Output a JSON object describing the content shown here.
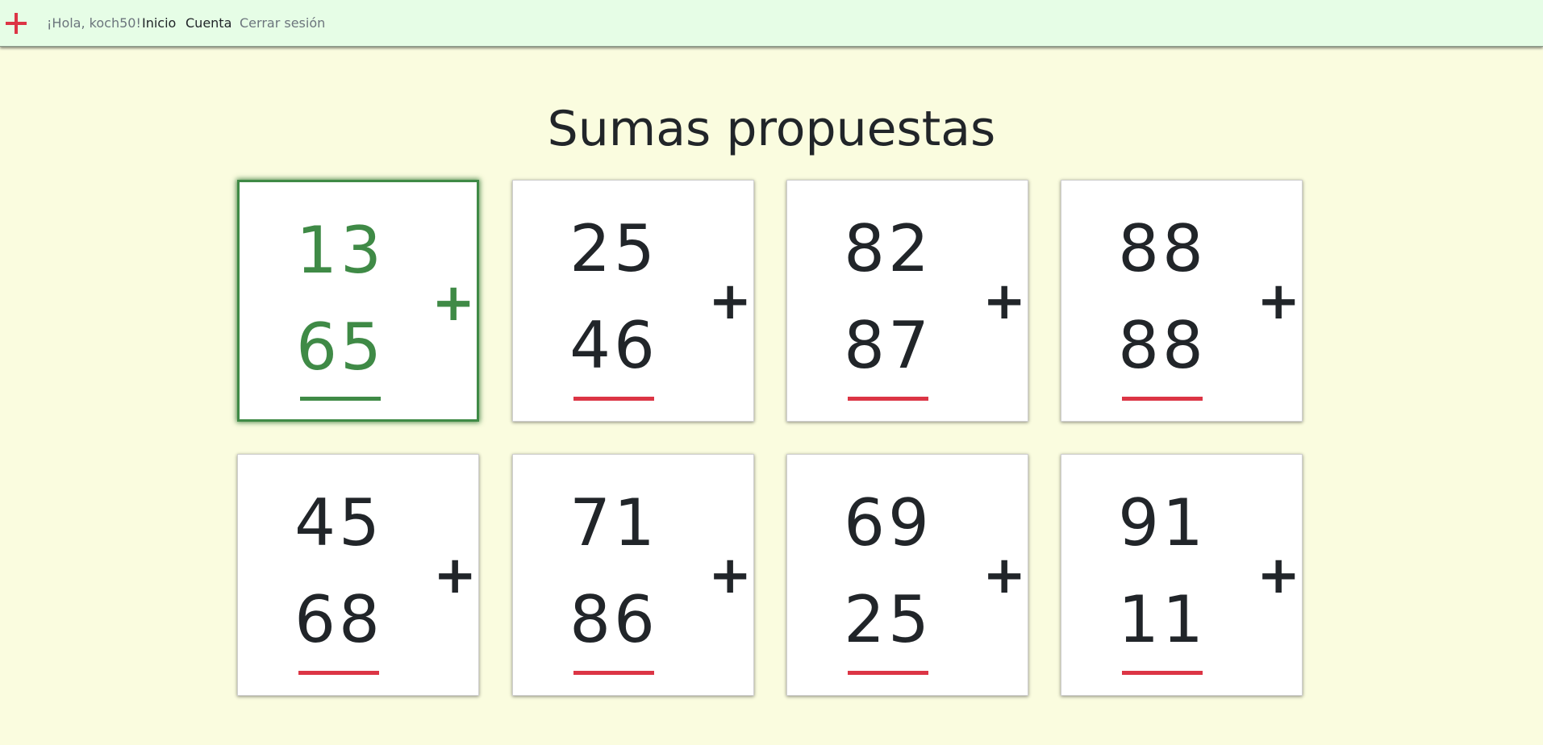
{
  "navbar": {
    "greeting": "¡Hola, koch50!",
    "home": "Inicio",
    "account": "Cuenta",
    "logout": "Cerrar sesión"
  },
  "page": {
    "title": "Sumas propuestas"
  },
  "sums": [
    {
      "top": "13",
      "bottom": "65",
      "operator": "+",
      "selected": true
    },
    {
      "top": "25",
      "bottom": "46",
      "operator": "+",
      "selected": false
    },
    {
      "top": "82",
      "bottom": "87",
      "operator": "+",
      "selected": false
    },
    {
      "top": "88",
      "bottom": "88",
      "operator": "+",
      "selected": false
    },
    {
      "top": "45",
      "bottom": "68",
      "operator": "+",
      "selected": false
    },
    {
      "top": "71",
      "bottom": "86",
      "operator": "+",
      "selected": false
    },
    {
      "top": "69",
      "bottom": "25",
      "operator": "+",
      "selected": false
    },
    {
      "top": "91",
      "bottom": "11",
      "operator": "+",
      "selected": false
    }
  ],
  "colors": {
    "brand": "#dc3545",
    "selected": "#3f8a46",
    "underline": "#dc3545",
    "navbar_bg": "#e6fde6",
    "page_bg": "#fafcdf"
  },
  "icons": {
    "brand": "plus-icon"
  }
}
